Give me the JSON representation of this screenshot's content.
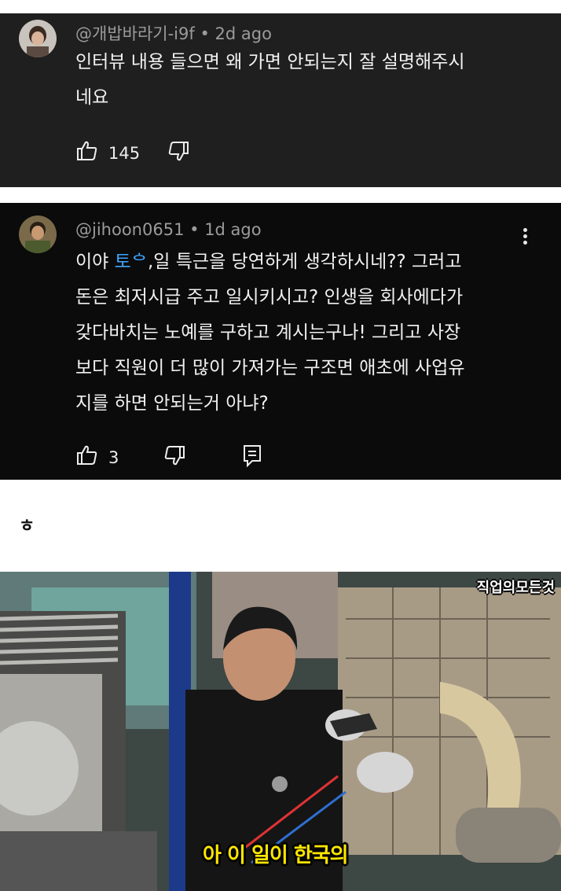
{
  "comments": [
    {
      "handle": "@개밥바라기-i9f",
      "time": "2d ago",
      "lines": [
        "인터뷰 내용 들으면 왜 가면 안되는지 잘 설명해주시",
        "네요"
      ],
      "likes": "145"
    },
    {
      "handle": "@jihoon0651",
      "time": "1d ago",
      "mention": "토ᅌ",
      "line1_rest": ",일 특근을 당연하게 생각하시네?? 그러고",
      "line1_prefix": "이야 ",
      "lines": [
        "돈은 최저시급 주고 일시키시고? 인생을 회사에다가",
        "갖다바치는 노예를 구하고 계시는구나! 그리고 사장",
        "보다 직원이 더 많이 가져가는 구조면 애초에 사업유",
        "지를 하면 안되는거 아냐?"
      ],
      "likes": "3"
    }
  ],
  "separator_text": "ㅎ",
  "video": {
    "channel_watermark": "직업의모든것",
    "subtitle": "아 이 일이 한국의"
  },
  "colors": {
    "mention": "#3ea6ff",
    "subtitle": "#ffe600"
  },
  "icons": [
    "like-icon",
    "dislike-icon",
    "reply-icon",
    "more-icon"
  ]
}
